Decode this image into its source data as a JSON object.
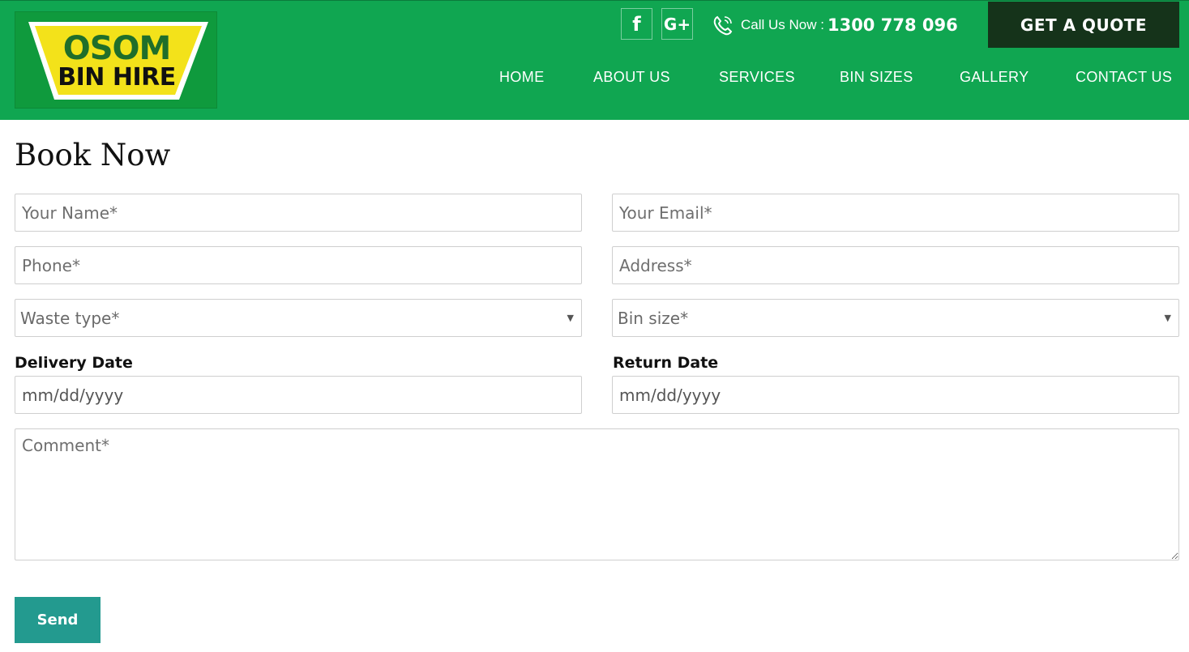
{
  "brand": {
    "logo_line1": "OSOM",
    "logo_line2": "BIN HIRE",
    "colors": {
      "header_green": "#10a651",
      "quote_dark": "#15331a",
      "logo_yellow": "#f3e21a",
      "send_teal": "#239a8f"
    }
  },
  "header": {
    "social": [
      {
        "icon": "facebook-icon",
        "glyph": "f"
      },
      {
        "icon": "google-plus-icon",
        "glyph": "G+"
      }
    ],
    "call_label": "Call Us Now :",
    "call_number": "1300 778 096",
    "quote_button": "GET A QUOTE",
    "nav": [
      "HOME",
      "ABOUT US",
      "SERVICES",
      "BIN SIZES",
      "GALLERY",
      "CONTACT US"
    ]
  },
  "form": {
    "title": "Book Now",
    "name_placeholder": "Your Name*",
    "email_placeholder": "Your Email*",
    "phone_placeholder": "Phone*",
    "address_placeholder": "Address*",
    "waste_type": "Waste type*",
    "bin_size": "Bin size*",
    "delivery_label": "Delivery Date",
    "delivery_value": "mm/dd/yyyy",
    "return_label": "Return Date",
    "return_value": "mm/dd/yyyy",
    "comment_placeholder": "Comment*",
    "send_button": "Send"
  }
}
